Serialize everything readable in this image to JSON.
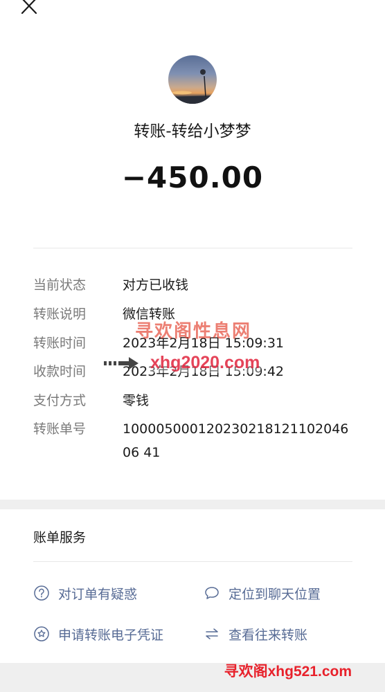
{
  "header": {
    "close_icon": "close-icon"
  },
  "transfer": {
    "title": "转账-转给小梦梦",
    "amount": "−450.00"
  },
  "details": [
    {
      "label": "当前状态",
      "value": "对方已收钱"
    },
    {
      "label": "转账说明",
      "value": "微信转账"
    },
    {
      "label": "转账时间",
      "value": "2023年2月18日 15:09:31"
    },
    {
      "label": "收款时间",
      "value": "2023年2月18日 15:09:42"
    },
    {
      "label": "支付方式",
      "value": "零钱"
    },
    {
      "label": "转账单号",
      "value": "10000500012023021812110204606 41"
    }
  ],
  "services": {
    "title": "账单服务",
    "items": [
      {
        "label": "对订单有疑惑",
        "icon": "question-icon"
      },
      {
        "label": "定位到聊天位置",
        "icon": "chat-bubble-icon"
      },
      {
        "label": "申请转账电子凭证",
        "icon": "badge-star-icon"
      },
      {
        "label": "查看往来转账",
        "icon": "swap-arrows-icon"
      }
    ]
  },
  "watermarks": {
    "mid_text": "寻欢阁性息网",
    "mid_url": "xhg2020.com",
    "bottom": "寻欢阁xhg521.com"
  },
  "colors": {
    "link": "#576b95",
    "label": "#7a7a7a",
    "watermark": "#e8212b"
  }
}
